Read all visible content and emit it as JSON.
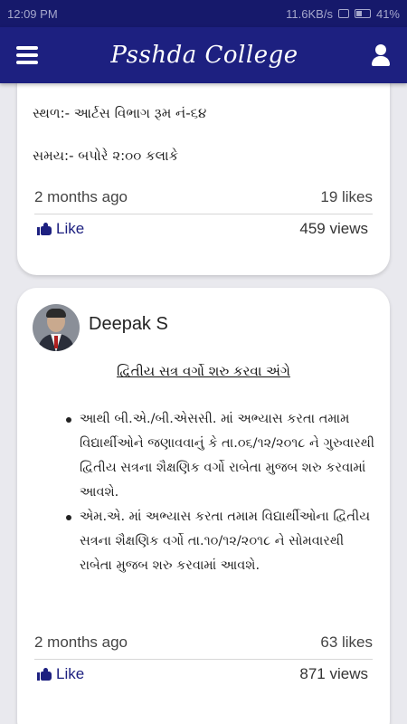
{
  "status_bar": {
    "time": "12:09 PM",
    "network_speed": "11.6KB/s",
    "battery": "41%"
  },
  "app_bar": {
    "title": "Psshda College",
    "menu_icon": "menu-icon",
    "profile_icon": "user-icon"
  },
  "posts": [
    {
      "lines": [
        "સ્થળ:- આર્ટસ વિભાગ રૂમ નં-૬૪",
        "સમય:- બપોરે ૨:૦૦ કલાકે"
      ],
      "time_ago": "2 months ago",
      "likes": "19 likes",
      "like_label": "Like",
      "views": "459 views"
    },
    {
      "author": "Deepak S",
      "title": "દ્વિતીય સત્ર વર્ગો શરુ કરવા અંગે",
      "bullets": [
        "આથી બી.એ./બી.એસસી. માં અભ્યાસ કરતા તમામ વિદ્યાર્થીઓને જણાવવાનું કે તા.૦૬/૧૨/૨૦૧૮ ને ગુરુવારથી દ્વિતીય સત્રના શૈક્ષણિક વર્ગો રાબેતા મુજબ શરુ કરવામાં આવશે.",
        "એમ.એ. માં અભ્યાસ કરતા તમામ વિદ્યાર્થીઓના દ્વિતીય સત્રના શૈક્ષણિક વર્ગો તા.૧૦/૧૨/૨૦૧૮ ને સોમવારથી રાબેતા મુજબ શરુ કરવામાં આવશે."
      ],
      "time_ago": "2 months ago",
      "likes": "63 likes",
      "like_label": "Like",
      "views": "871 views"
    }
  ],
  "colors": {
    "app_bar": "#1d2080",
    "status_bar": "#16196b",
    "background": "#e9e9ee",
    "like_accent": "#1d2080"
  }
}
